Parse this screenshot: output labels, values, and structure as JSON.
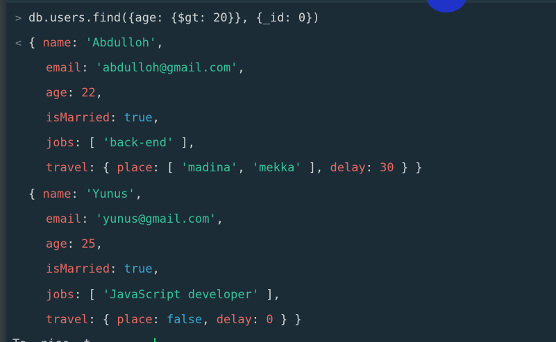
{
  "command": {
    "prompt_glyph": ">",
    "text": "db.users.find({age: {$gt: 20}}, {_id: 0})"
  },
  "result_glyph": "<",
  "documents": [
    {
      "name": "'Abdulloh'",
      "email": "'abdulloh@gmail.com'",
      "age": "22",
      "isMarried": "true",
      "jobs": "'back-end'",
      "travel_place_1": "'madina'",
      "travel_place_2": "'mekka'",
      "travel_delay": "30"
    },
    {
      "name": "'Yunus'",
      "email": "'yunus@gmail.com'",
      "age": "25",
      "isMarried": "true",
      "jobs": "'JavaScript developer'",
      "travel_place": "false",
      "travel_delay": "0"
    }
  ],
  "keys": {
    "name": "name",
    "email": "email",
    "age": "age",
    "isMarried": "isMarried",
    "jobs": "jobs",
    "travel": "travel",
    "place": "place",
    "delay": "delay"
  },
  "next_prompt_partial": "Ta  nise  t  ",
  "colors": {
    "background": "#1b2c36",
    "key": "#e56a63",
    "string": "#38c39a",
    "boolean": "#3aa7cf",
    "text": "#d4d7d7",
    "cursor": "#1f33c9",
    "caret": "#1ed56b"
  }
}
